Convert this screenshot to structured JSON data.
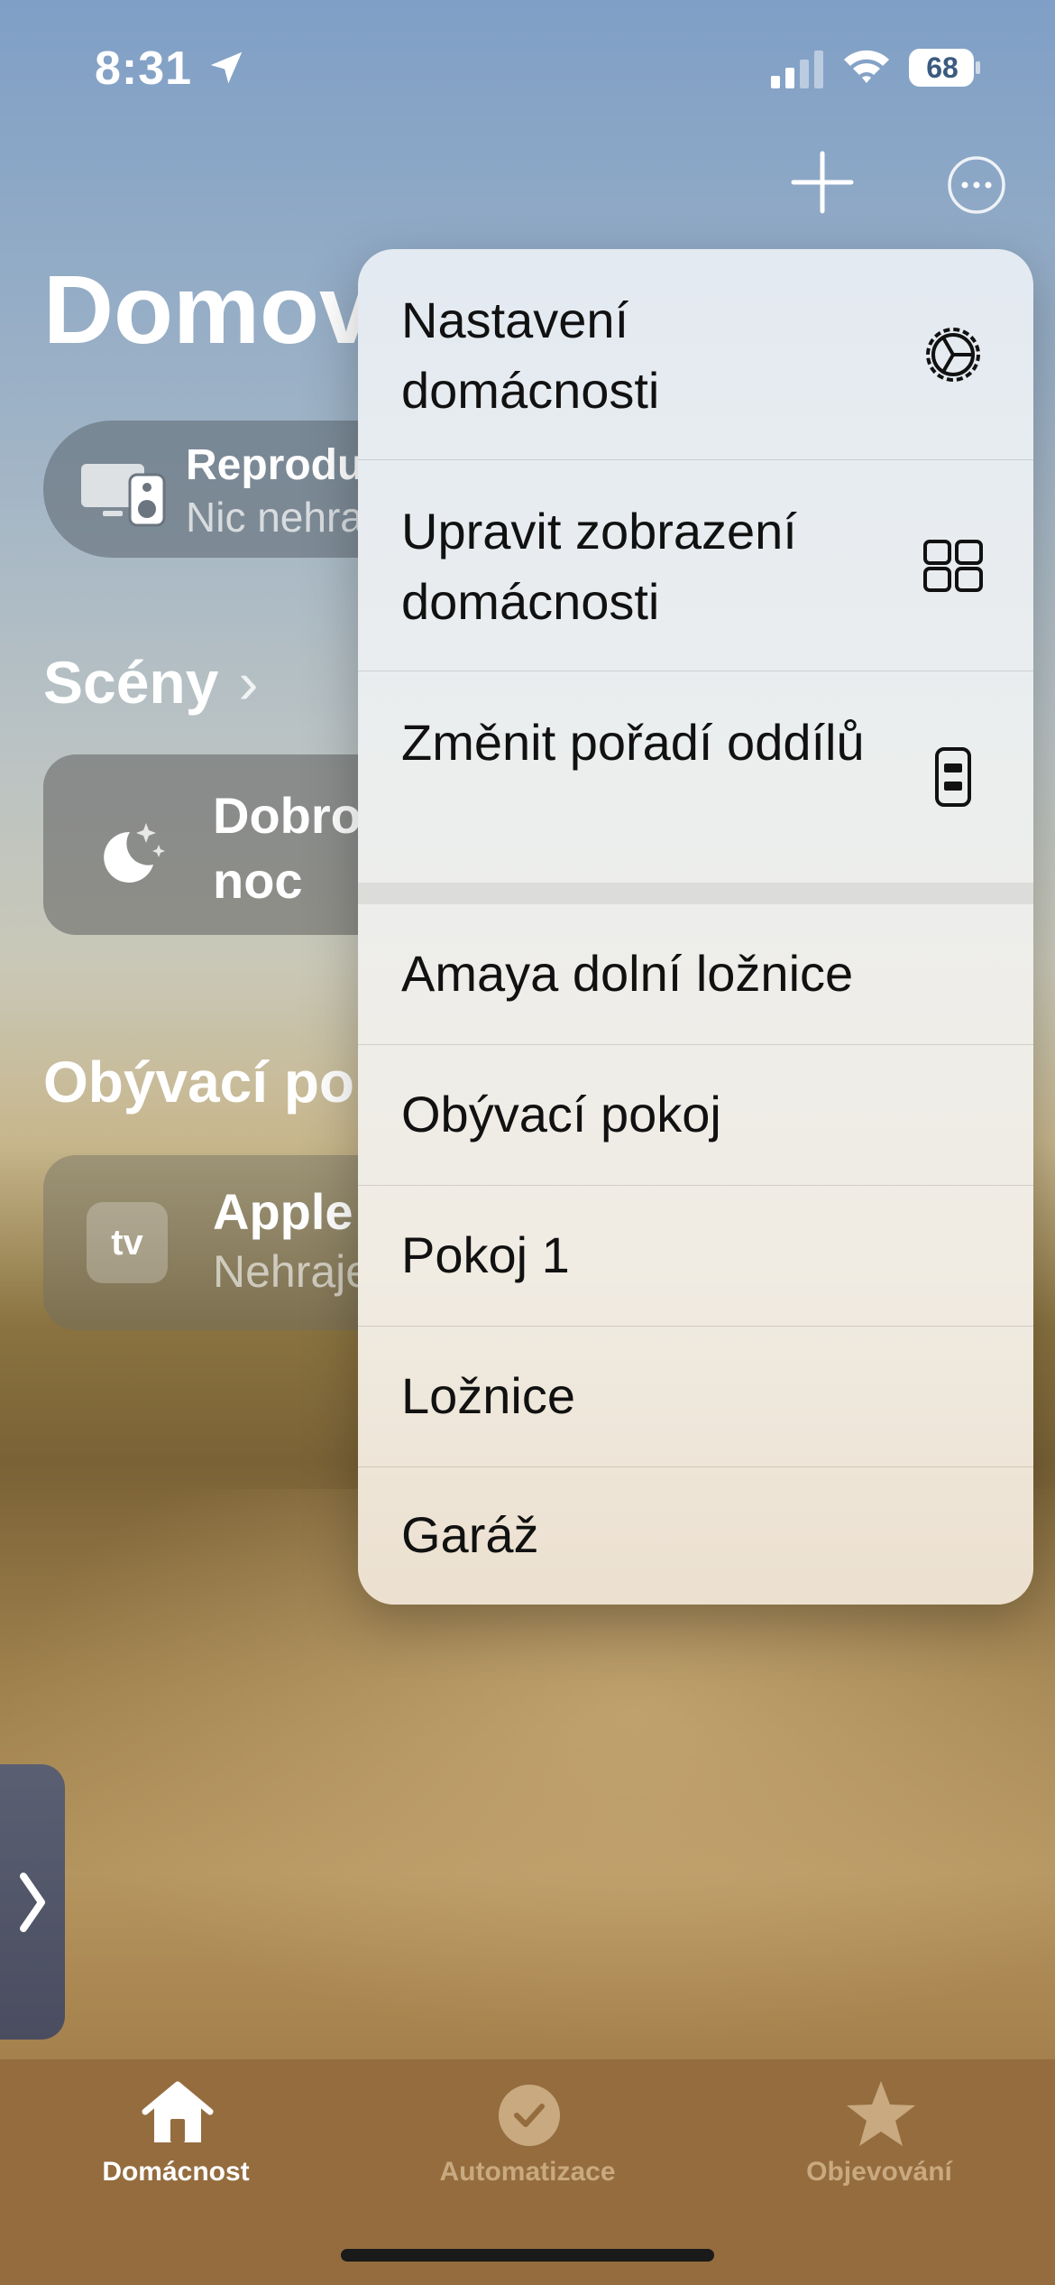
{
  "status_bar": {
    "time": "8:31",
    "battery": "68"
  },
  "home": {
    "title": "Domov",
    "speaker": {
      "title": "Reproduktory a TV",
      "subtitle": "Nic nehraje"
    },
    "scenes_title": "Scény",
    "scene": {
      "label": "Dobrou noc"
    },
    "room_title": "Obývací pokoj",
    "apple_tv": {
      "title": "Apple TV",
      "subtitle": "Nehraje"
    }
  },
  "menu": {
    "items": [
      {
        "label": "Nastavení domácnosti",
        "icon": "gear-icon"
      },
      {
        "label": "Upravit zobrazení domácnosti",
        "icon": "grid-icon"
      },
      {
        "label": "Změnit pořadí oddílů",
        "icon": "reorder-icon"
      }
    ],
    "rooms": [
      {
        "label": "Amaya dolní ložnice"
      },
      {
        "label": "Obývací pokoj"
      },
      {
        "label": "Pokoj 1"
      },
      {
        "label": "Ložnice"
      },
      {
        "label": "Garáž"
      }
    ]
  },
  "tabs": [
    {
      "label": "Domácnost",
      "icon": "house-icon",
      "active": true
    },
    {
      "label": "Automatizace",
      "icon": "clock-check-icon",
      "active": false
    },
    {
      "label": "Objevování",
      "icon": "star-icon",
      "active": false
    }
  ],
  "colors": {
    "tab_active": "#ffffff",
    "tab_inactive": "#c9a97f",
    "tab_background": "#946c3e"
  }
}
